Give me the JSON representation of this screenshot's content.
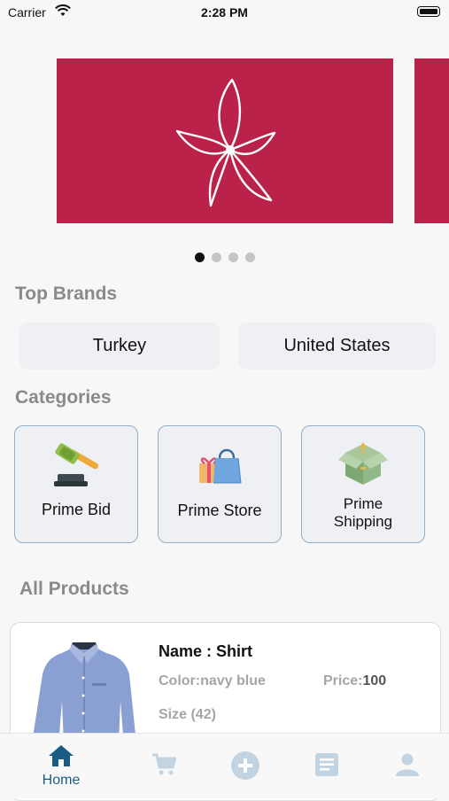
{
  "status_bar": {
    "carrier": "Carrier",
    "time": "2:28 PM"
  },
  "carousel": {
    "slide_count": 4,
    "active_index": 0,
    "brand_color": "#bb2249"
  },
  "sections": {
    "top_brands": "Top Brands",
    "categories": "Categories",
    "all_products": "All Products"
  },
  "brands": [
    {
      "label": "Turkey"
    },
    {
      "label": "United States"
    }
  ],
  "categories": [
    {
      "label": "Prime Bid",
      "icon": "gavel-icon"
    },
    {
      "label": "Prime Store",
      "icon": "shopping-bags-icon"
    },
    {
      "label": "Prime\nShipping",
      "icon": "shipping-box-icon"
    }
  ],
  "product": {
    "name": "Name : Shirt",
    "color": "Color:navy blue",
    "price_label": "Price:",
    "price_value": "100",
    "size": "Size (42)"
  },
  "tabs": [
    {
      "label": "Home",
      "icon": "home-icon",
      "active": true
    },
    {
      "label": "",
      "icon": "cart-icon",
      "active": false
    },
    {
      "label": "",
      "icon": "add-circle-icon",
      "active": false
    },
    {
      "label": "",
      "icon": "document-icon",
      "active": false
    },
    {
      "label": "",
      "icon": "profile-icon",
      "active": false
    }
  ],
  "colors": {
    "accent": "#1b5c84",
    "tab_inactive": "#c2d4e2",
    "section_title": "#8a8a8a"
  }
}
